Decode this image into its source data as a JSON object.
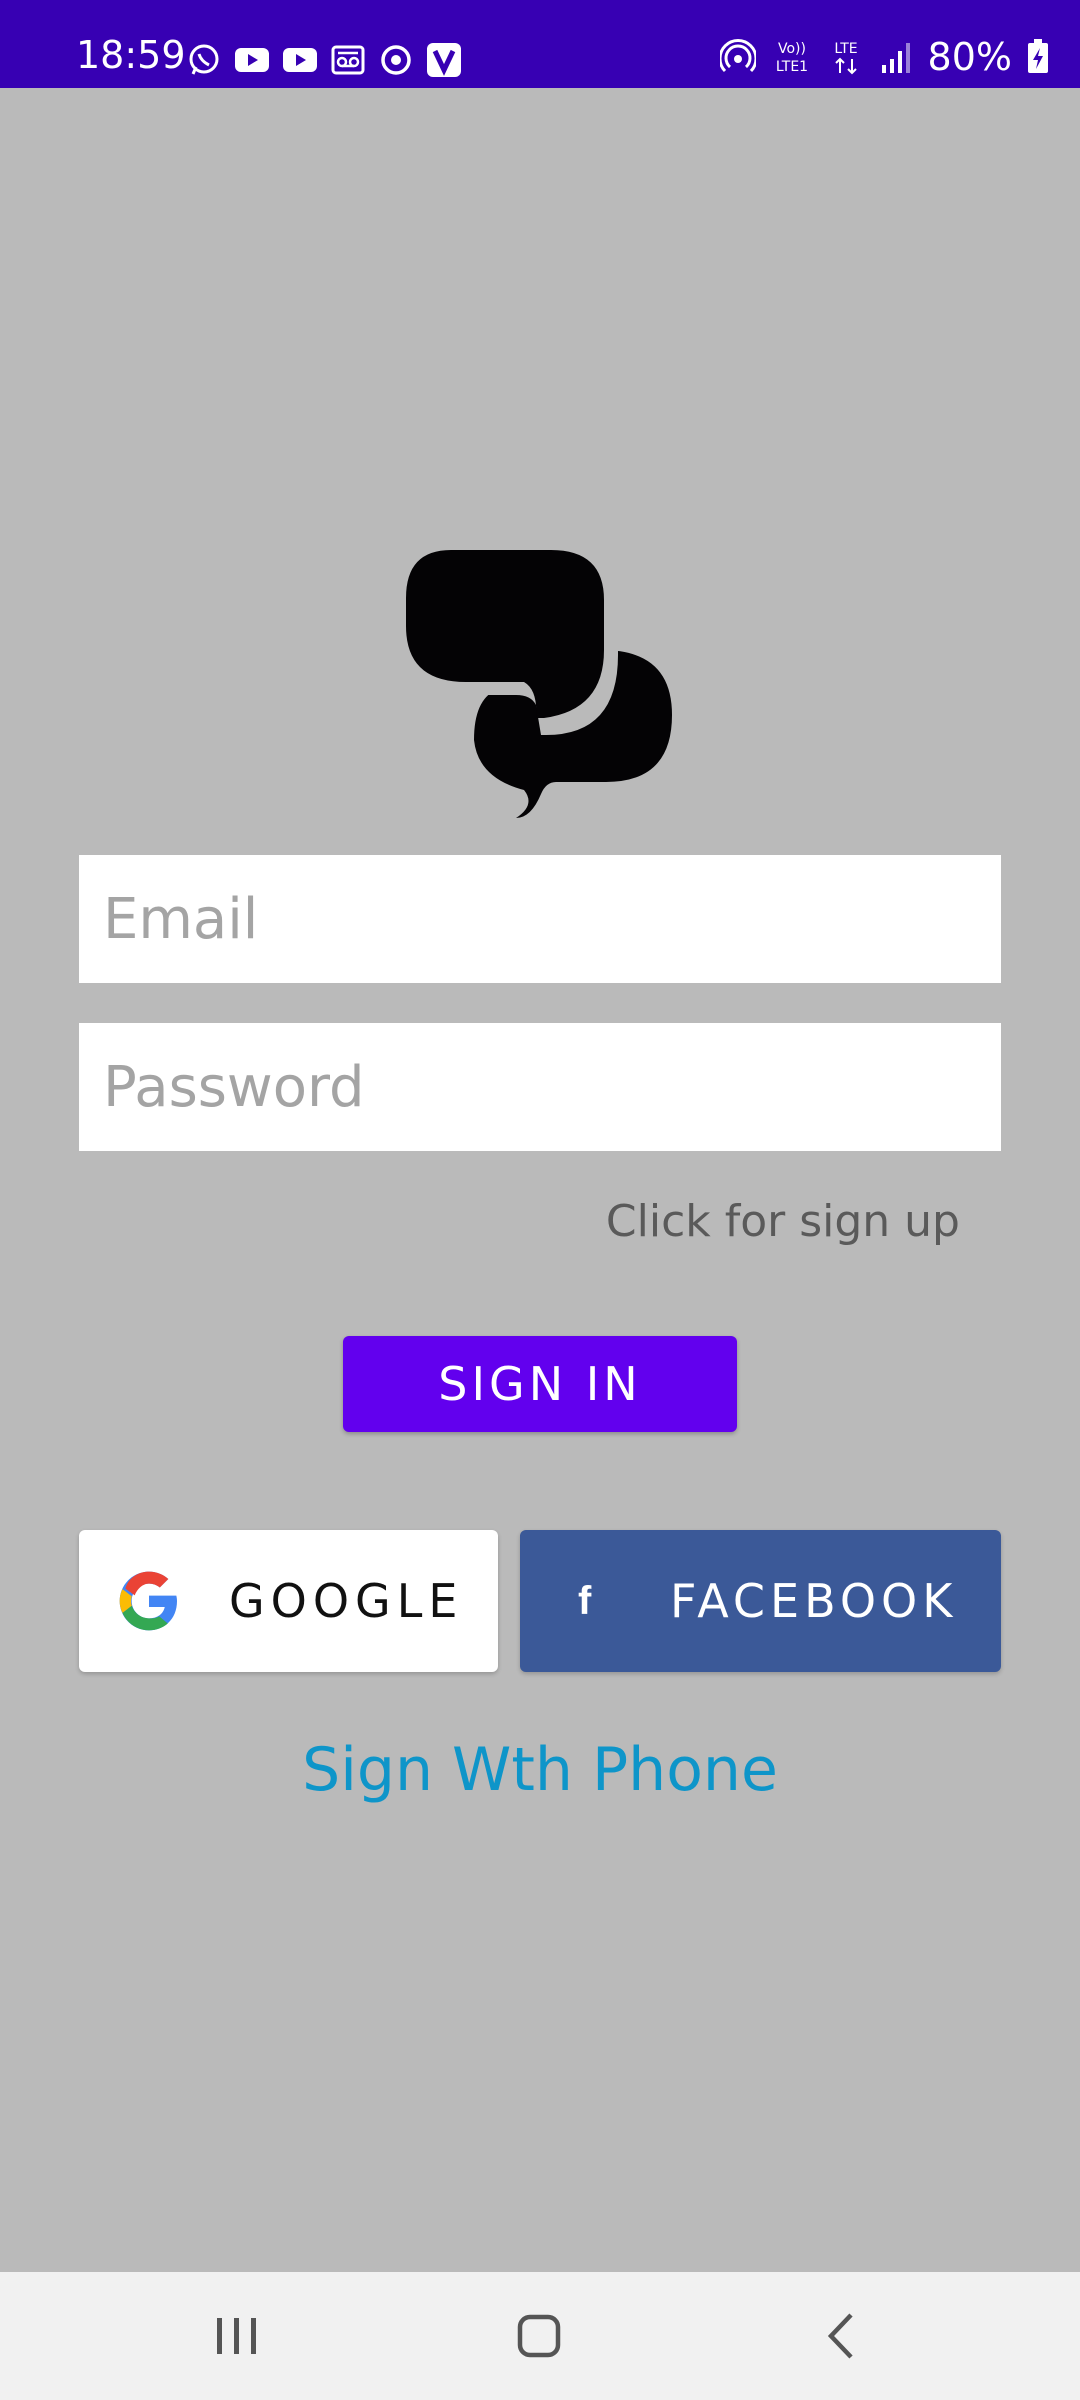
{
  "status_bar": {
    "time": "18:59",
    "battery": "80%",
    "network_label_top": "Vo))",
    "network_label_bottom": "LTE1",
    "lte_label": "LTE",
    "notification_icons": [
      "whatsapp-icon",
      "youtube-icon",
      "youtube-icon",
      "voicemail-icon",
      "sync-icon",
      "v-icon"
    ],
    "right_icons": [
      "hotspot-icon",
      "volte-icon",
      "lte-data-icon",
      "signal-icon",
      "battery-charging-icon"
    ]
  },
  "logo": {
    "icon": "chat-bubbles-icon"
  },
  "form": {
    "email_placeholder": "Email",
    "email_value": "",
    "password_placeholder": "Password",
    "password_value": "",
    "signup_text": "Click for sign up",
    "signin_label": "SIGN IN"
  },
  "social": {
    "google_label": "GOOGLE",
    "facebook_label": "FACEBOOK",
    "facebook_icon_glyph": "f",
    "phone_label": "Sign Wth Phone"
  },
  "colors": {
    "status_bar": "#3700b3",
    "background": "#bababa",
    "primary": "#6200ee",
    "facebook": "#3b5998",
    "link": "#0e95c9"
  },
  "nav_bar": {
    "icons": [
      "recent-apps-icon",
      "home-icon",
      "back-icon"
    ]
  }
}
